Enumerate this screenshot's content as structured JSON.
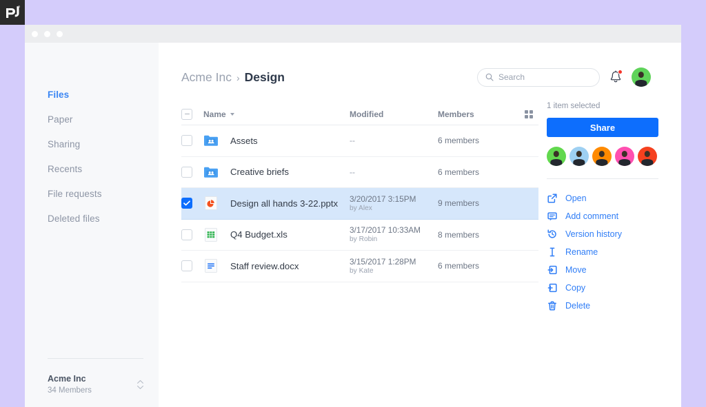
{
  "brand": {
    "logo_text": "pd",
    "logo_mark": "pandadoc-logo-icon"
  },
  "window": {
    "dots": 3
  },
  "sidebar": {
    "items": [
      {
        "label": "Files",
        "active": true
      },
      {
        "label": "Paper",
        "active": false
      },
      {
        "label": "Sharing",
        "active": false
      },
      {
        "label": "Recents",
        "active": false
      },
      {
        "label": "File requests",
        "active": false
      },
      {
        "label": "Deleted files",
        "active": false
      }
    ],
    "team": {
      "name": "Acme Inc",
      "members": "34 Members"
    }
  },
  "header": {
    "breadcrumb": {
      "parent": "Acme Inc",
      "separator": "›",
      "current": "Design"
    },
    "search": {
      "placeholder": "Search",
      "value": "",
      "icon": "search-icon"
    },
    "notifications": {
      "icon": "bell-icon",
      "has_unread": true,
      "dot_color": "#f5352b"
    },
    "user_avatar": {
      "name": "user-avatar",
      "bg": "#5fd35a"
    }
  },
  "table": {
    "columns": {
      "name": "Name",
      "modified": "Modified",
      "members": "Members",
      "view_toggle_icon": "grid-view-icon"
    },
    "sort": {
      "column": "Name",
      "direction": "asc",
      "icon": "caret-down-icon"
    },
    "select_all_state": "indeterminate",
    "rows": [
      {
        "name": "Assets",
        "icon": "shared-folder-icon",
        "icon_color": "#4aa1f3",
        "modified": "--",
        "modified_by": "",
        "members": "6 members",
        "selected": false
      },
      {
        "name": "Creative briefs",
        "icon": "shared-folder-icon",
        "icon_color": "#4aa1f3",
        "modified": "--",
        "modified_by": "",
        "members": "6 members",
        "selected": false
      },
      {
        "name": "Design all hands 3-22.pptx",
        "icon": "powerpoint-file-icon",
        "icon_color": "#f4511e",
        "modified": "3/20/2017 3:15PM",
        "modified_by": "by Alex",
        "members": "9 members",
        "selected": true
      },
      {
        "name": "Q4 Budget.xls",
        "icon": "excel-file-icon",
        "icon_color": "#2bb24c",
        "modified": "3/17/2017 10:33AM",
        "modified_by": "by Robin",
        "members": "8 members",
        "selected": false
      },
      {
        "name": "Staff review.docx",
        "icon": "word-file-icon",
        "icon_color": "#2f7df6",
        "modified": "3/15/2017 1:28PM",
        "modified_by": "by Kate",
        "members": "6 members",
        "selected": false
      }
    ]
  },
  "panel": {
    "selection_text": "1 item selected",
    "share_label": "Share",
    "avatars": [
      {
        "name": "member-avatar-1",
        "bg": "#62d84e"
      },
      {
        "name": "member-avatar-2",
        "bg": "#9ed0f2"
      },
      {
        "name": "member-avatar-3",
        "bg": "#ff8a00"
      },
      {
        "name": "member-avatar-4",
        "bg": "#ff4fb0"
      },
      {
        "name": "member-avatar-5",
        "bg": "#f5411f"
      }
    ],
    "actions": [
      {
        "label": "Open",
        "icon": "open-external-icon"
      },
      {
        "label": "Add comment",
        "icon": "comment-icon"
      },
      {
        "label": "Version history",
        "icon": "history-icon"
      },
      {
        "label": "Rename",
        "icon": "text-cursor-icon"
      },
      {
        "label": "Move",
        "icon": "move-into-icon"
      },
      {
        "label": "Copy",
        "icon": "copy-into-icon"
      },
      {
        "label": "Delete",
        "icon": "trash-icon"
      }
    ]
  },
  "colors": {
    "page_background": "#d4ccfb",
    "accent_blue": "#0d6efd",
    "link_blue": "#2f7df6",
    "selected_row": "#d6e7fb",
    "sidebar_bg": "#f7f8fa"
  }
}
